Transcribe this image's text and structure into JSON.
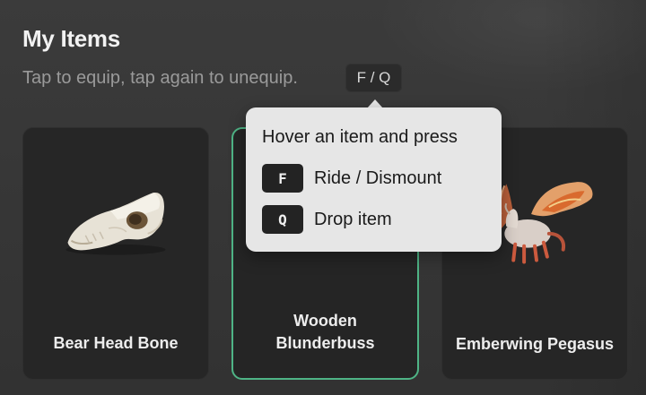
{
  "header": {
    "title": "My Items",
    "subtitle": "Tap to equip, tap again to unequip.",
    "key_hint": "F / Q"
  },
  "items": [
    {
      "name": "Bear Head Bone",
      "icon": "bear-skull-icon",
      "equipped": false
    },
    {
      "name": "Wooden Blunderbuss",
      "icon": "blunderbuss-icon",
      "equipped": true
    },
    {
      "name": "Emberwing Pegasus",
      "icon": "pegasus-icon",
      "equipped": false
    }
  ],
  "tooltip": {
    "title": "Hover an item and press",
    "shortcuts": [
      {
        "key": "F",
        "label": "Ride / Dismount"
      },
      {
        "key": "Q",
        "label": "Drop item"
      }
    ]
  },
  "colors": {
    "background": "#3a3a3a",
    "card": "#262626",
    "equipped_border": "#4fb486",
    "tooltip_bg": "#e6e6e6",
    "key_bg": "#232323"
  }
}
